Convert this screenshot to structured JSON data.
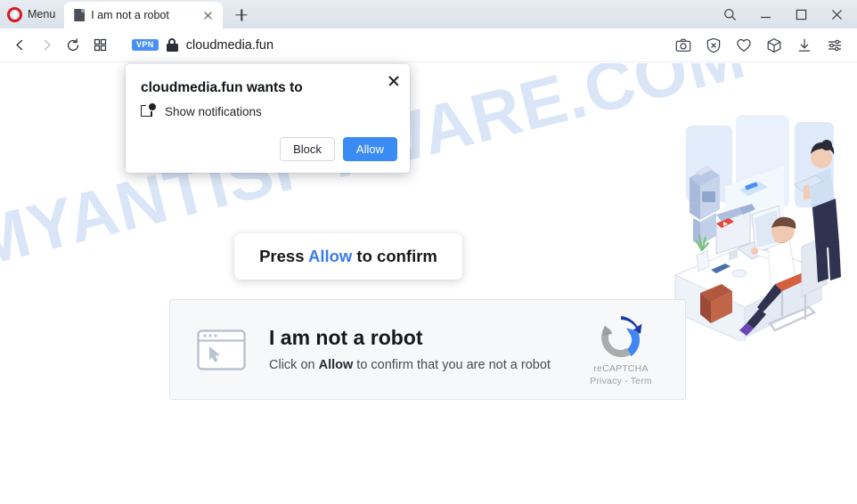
{
  "browser": {
    "name": "Opera",
    "menu_label": "Menu",
    "tab": {
      "title": "I am not a robot",
      "favicon": "page-icon",
      "close_icon": "close-icon"
    },
    "new_tab_icon": "plus-icon",
    "window_controls": [
      {
        "name": "search-icon",
        "glyph": "search"
      },
      {
        "name": "minimize-icon",
        "glyph": "minimize"
      },
      {
        "name": "maximize-icon",
        "glyph": "maximize"
      },
      {
        "name": "close-icon",
        "glyph": "close"
      }
    ],
    "toolbar": {
      "back_icon": "back-arrow-icon",
      "forward_icon": "forward-arrow-icon",
      "reload_icon": "reload-icon",
      "speeddial_icon": "speed-dial-icon",
      "vpn_badge": "VPN",
      "lock_icon": "padlock-icon",
      "url": "cloudmedia.fun",
      "right_icons": [
        {
          "name": "snapshot-camera-icon"
        },
        {
          "name": "ad-blocker-shield-icon"
        },
        {
          "name": "heart-favorites-icon"
        },
        {
          "name": "cube-extensions-icon"
        },
        {
          "name": "downloads-icon"
        },
        {
          "name": "easy-setup-sliders-icon"
        }
      ]
    }
  },
  "notification_dialog": {
    "title": "cloudmedia.fun wants to",
    "permission_icon": "notification-badge-icon",
    "permission_label": "Show notifications",
    "close_icon": "close-icon",
    "block_label": "Block",
    "allow_label": "Allow",
    "allow_color": "#3b8bf5"
  },
  "page": {
    "watermark": "MYANTISPYWARE.COM",
    "watermark_color": "#c5d8f5",
    "press_prompt": {
      "before": "Press ",
      "highlight": "Allow",
      "after": " to confirm",
      "highlight_color": "#3a7ced"
    },
    "captcha": {
      "window_icon": "browser-window-cursor-icon",
      "heading": "I am not a robot",
      "sub_before": "Click on ",
      "sub_bold": "Allow",
      "sub_after": " to confirm that you are not a robot",
      "recaptcha_logo": "recaptcha-logo-icon",
      "recaptcha_name": "reCAPTCHA",
      "recaptcha_links": "Privacy - Term"
    },
    "illustration": "isometric-office-robot-illustration"
  }
}
